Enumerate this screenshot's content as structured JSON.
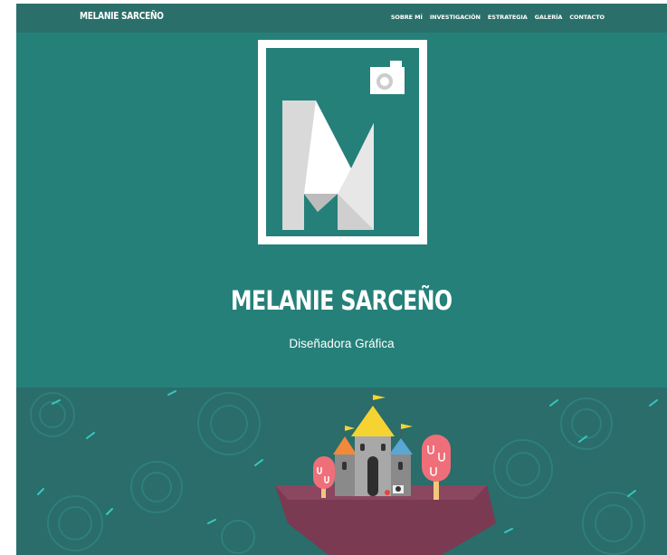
{
  "nav": {
    "brand": "MELANIE SARCEÑO",
    "links": [
      "SOBRE MÍ",
      "INVESTIGACIÓN",
      "ESTRATEGIA",
      "GALERÍA",
      "CONTACTO"
    ]
  },
  "hero": {
    "logo_icon": "camera-m-logo",
    "title": "MELANIE SARCEÑO",
    "subtitle": "Diseñadora Gráfica"
  },
  "scene": {
    "illustration": "floating-castle-island"
  },
  "colors": {
    "hero_bg": "#258079",
    "navbar_bg": "#2a6f6a",
    "scene_bg": "#2a6d6a",
    "text": "#ffffff"
  }
}
